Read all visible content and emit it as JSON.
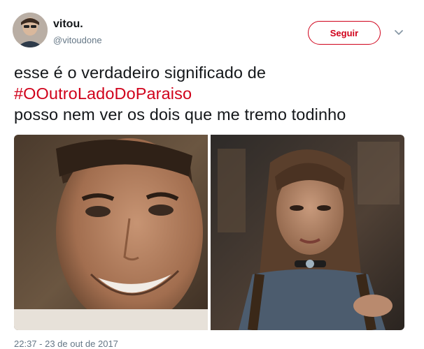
{
  "user": {
    "display_name": "vitou.",
    "handle": "@vitoudone"
  },
  "header": {
    "follow_label": "Seguir",
    "more_icon": "chevron-down-icon"
  },
  "tweet": {
    "line1": "esse é o verdadeiro significado de",
    "hashtag": "#OOutroLadoDoParaiso",
    "line3": "posso nem ver os dois que me tremo todinho",
    "timestamp": "22:37 - 23 de out de 2017"
  },
  "media": {
    "count": 2
  },
  "colors": {
    "accent": "#d0021b",
    "secondary_text": "#657786",
    "primary_text": "#14171a"
  }
}
